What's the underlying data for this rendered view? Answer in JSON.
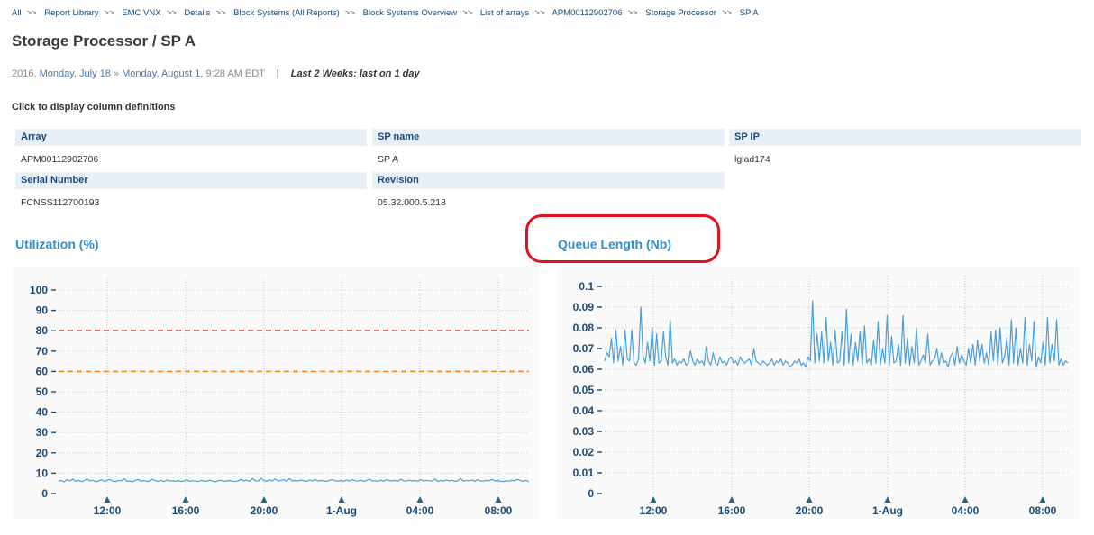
{
  "breadcrumb": {
    "items": [
      "All",
      "Report Library",
      "EMC VNX",
      "Details",
      "Block Systems (All Reports)",
      "Block Systems Overview",
      "List of arrays",
      "APM00112902706",
      "Storage Processor"
    ],
    "current": "SP A",
    "separator": ">>"
  },
  "page": {
    "title": "Storage Processor / SP A"
  },
  "date_range": {
    "year": "2016,",
    "start": "Monday, July 18",
    "arrow": "»",
    "end": "Monday, August 1,",
    "time": "9:28 AM EDT",
    "divider": "|",
    "period": "Last 2 Weeks: last on 1 day"
  },
  "column_definitions_link": "Click to display column definitions",
  "properties": {
    "array_label": "Array",
    "array_value": "APM00112902706",
    "sp_name_label": "SP name",
    "sp_name_value": "SP A",
    "sp_ip_label": "SP IP",
    "sp_ip_value": "lglad174",
    "serial_label": "Serial Number",
    "serial_value": "FCNSS112700193",
    "revision_label": "Revision",
    "revision_value": "05.32.000.5.218"
  },
  "colors": {
    "line": "#4a9fd8",
    "critical": "#d91a1a",
    "warning": "#f08a1a",
    "highlight": "#e0121d",
    "title": "#2e8fd0",
    "axis": "#1a4a7a"
  },
  "chart_data": [
    {
      "type": "line",
      "title": "Utilization (%)",
      "x_ticks": [
        "12:00",
        "16:00",
        "20:00",
        "1-Aug",
        "04:00",
        "08:00"
      ],
      "y_ticks": [
        "0",
        "10",
        "20",
        "30",
        "40",
        "50",
        "60",
        "70",
        "80",
        "90",
        "100"
      ],
      "ylim": [
        0,
        100
      ],
      "thresholds": [
        {
          "value": 80,
          "color": "critical"
        },
        {
          "value": 60,
          "color": "warning"
        }
      ],
      "series_values": [
        6.1,
        6.4,
        5.8,
        6.9,
        6.2,
        7.1,
        6.0,
        6.5,
        5.9,
        6.3,
        7.2,
        6.1,
        6.6,
        5.8,
        6.2,
        6.8,
        6.0,
        6.4,
        7.0,
        6.1,
        5.9,
        6.5,
        6.3,
        7.3,
        6.0,
        6.2,
        5.8,
        6.6,
        6.9,
        6.1,
        6.4,
        5.9,
        6.2,
        7.1,
        6.3,
        6.0,
        6.5,
        5.8,
        6.7,
        6.1,
        6.3,
        6.0,
        6.4,
        5.9,
        6.2,
        6.8,
        6.0,
        6.3,
        6.1,
        5.9,
        6.4,
        6.2,
        6.0,
        6.6,
        6.1,
        5.8,
        6.3,
        6.5,
        6.0,
        6.2,
        6.4,
        6.1,
        5.9,
        6.3,
        7.0,
        6.2,
        6.6,
        6.0,
        7.4,
        6.3,
        6.1,
        7.6,
        6.4,
        6.0,
        6.8,
        6.2,
        7.2,
        6.1,
        6.5,
        6.9,
        6.0,
        7.3,
        6.2,
        6.4,
        6.1,
        6.7,
        6.3,
        6.0,
        6.6,
        6.2,
        7.0,
        6.1,
        6.4,
        6.3,
        6.0,
        6.5,
        6.8,
        6.2,
        6.1,
        6.4,
        6.0,
        6.7,
        6.2,
        6.9,
        6.3,
        6.1,
        6.5,
        6.0,
        6.4,
        7.1,
        6.2,
        6.3,
        6.0,
        6.6,
        6.1,
        6.8,
        6.4,
        6.2,
        6.5,
        6.0,
        7.0,
        6.3,
        6.1,
        6.6,
        6.2,
        6.4,
        6.0,
        6.9,
        6.1,
        6.5,
        6.3,
        6.2,
        7.2,
        6.0,
        6.4,
        6.1,
        6.7,
        6.3,
        6.5,
        6.0,
        6.2,
        7.4,
        6.1,
        6.4,
        6.3,
        6.6,
        6.0,
        6.8,
        6.2,
        6.1,
        6.5,
        6.3,
        7.0,
        6.2,
        6.4,
        6.0,
        5.9,
        6.3,
        6.1,
        6.6,
        6.2,
        7.0,
        6.4,
        6.0,
        6.5,
        5.8
      ]
    },
    {
      "type": "line",
      "title": "Queue Length (Nb)",
      "x_ticks": [
        "12:00",
        "16:00",
        "20:00",
        "1-Aug",
        "04:00",
        "08:00"
      ],
      "y_ticks": [
        "0",
        "0.01",
        "0.02",
        "0.03",
        "0.04",
        "0.05",
        "0.06",
        "0.07",
        "0.08",
        "0.09",
        "0.1"
      ],
      "ylim": [
        0,
        0.1
      ],
      "series_values": [
        0.064,
        0.068,
        0.066,
        0.075,
        0.063,
        0.079,
        0.064,
        0.071,
        0.062,
        0.079,
        0.065,
        0.064,
        0.079,
        0.063,
        0.062,
        0.065,
        0.09,
        0.066,
        0.063,
        0.073,
        0.064,
        0.08,
        0.062,
        0.077,
        0.063,
        0.064,
        0.078,
        0.066,
        0.062,
        0.084,
        0.063,
        0.065,
        0.062,
        0.064,
        0.063,
        0.065,
        0.062,
        0.063,
        0.069,
        0.064,
        0.062,
        0.065,
        0.063,
        0.064,
        0.062,
        0.071,
        0.064,
        0.062,
        0.068,
        0.063,
        0.062,
        0.066,
        0.063,
        0.064,
        0.062,
        0.065,
        0.066,
        0.063,
        0.064,
        0.062,
        0.066,
        0.064,
        0.063,
        0.064,
        0.065,
        0.062,
        0.07,
        0.064,
        0.063,
        0.062,
        0.064,
        0.063,
        0.062,
        0.063,
        0.065,
        0.062,
        0.064,
        0.063,
        0.065,
        0.062,
        0.064,
        0.063,
        0.061,
        0.062,
        0.064,
        0.063,
        0.065,
        0.062,
        0.063,
        0.061,
        0.066,
        0.064,
        0.093,
        0.063,
        0.077,
        0.064,
        0.078,
        0.063,
        0.085,
        0.064,
        0.073,
        0.062,
        0.079,
        0.063,
        0.064,
        0.078,
        0.062,
        0.089,
        0.063,
        0.077,
        0.062,
        0.073,
        0.064,
        0.078,
        0.062,
        0.081,
        0.063,
        0.065,
        0.062,
        0.074,
        0.063,
        0.083,
        0.062,
        0.07,
        0.063,
        0.086,
        0.062,
        0.076,
        0.063,
        0.064,
        0.072,
        0.062,
        0.086,
        0.063,
        0.075,
        0.062,
        0.071,
        0.063,
        0.08,
        0.062,
        0.064,
        0.067,
        0.063,
        0.077,
        0.062,
        0.064,
        0.065,
        0.07,
        0.062,
        0.068,
        0.063,
        0.064,
        0.061,
        0.066,
        0.068,
        0.062,
        0.071,
        0.063,
        0.067,
        0.064,
        0.062,
        0.07,
        0.063,
        0.072,
        0.062,
        0.074,
        0.064,
        0.072,
        0.063,
        0.068,
        0.062,
        0.078,
        0.064,
        0.079,
        0.062,
        0.08,
        0.063,
        0.066,
        0.075,
        0.062,
        0.084,
        0.063,
        0.08,
        0.062,
        0.07,
        0.063,
        0.085,
        0.062,
        0.072,
        0.064,
        0.083,
        0.061,
        0.066,
        0.063,
        0.073,
        0.062,
        0.085,
        0.063,
        0.072,
        0.064,
        0.084,
        0.062,
        0.065,
        0.062,
        0.064,
        0.063
      ]
    }
  ]
}
